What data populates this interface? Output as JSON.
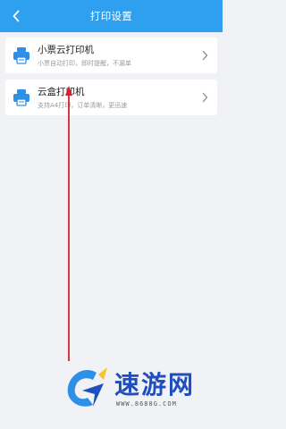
{
  "header": {
    "title": "打印设置"
  },
  "printers": [
    {
      "name": "小票云打印机",
      "desc": "小票自动打印，即时提醒，不漏单"
    },
    {
      "name": "云盒打印机",
      "desc": "支持A4打印，订单清晰，更迅速"
    }
  ],
  "watermark": {
    "name": "速游网",
    "url": "WWW.8688G.COM"
  },
  "colors": {
    "header": "#2fa0ef",
    "icon": "#2e8fe6",
    "arrow": "#d8202b",
    "watermark": "#1e4fbd"
  }
}
